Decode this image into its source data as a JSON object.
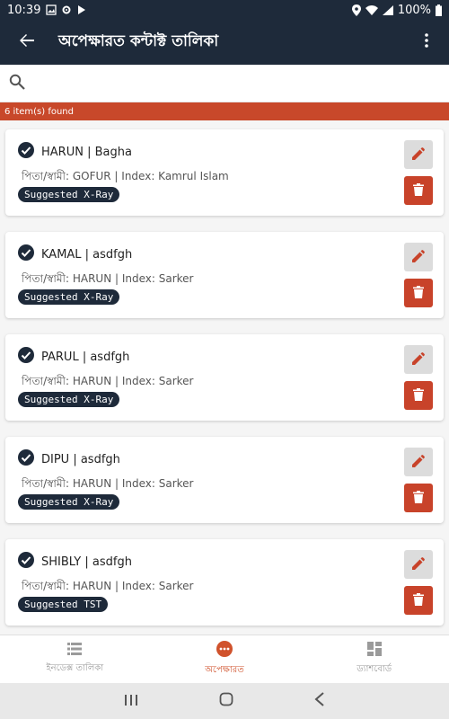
{
  "status_bar": {
    "time": "10:39",
    "battery": "100%"
  },
  "app_bar": {
    "title": "অপেক্ষারত কন্টাক্ট তালিকা"
  },
  "search": {
    "placeholder": ""
  },
  "results": {
    "count_text": "6 item(s) found"
  },
  "items": [
    {
      "name": "HARUN | Bagha",
      "parent": "পিতা/স্বামী: GOFUR | Index: Kamrul Islam",
      "badge": "Suggested X-Ray"
    },
    {
      "name": "KAMAL | asdfgh",
      "parent": "পিতা/স্বামী: HARUN | Index: Sarker",
      "badge": "Suggested X-Ray"
    },
    {
      "name": "PARUL | asdfgh",
      "parent": "পিতা/স্বামী: HARUN | Index: Sarker",
      "badge": "Suggested X-Ray"
    },
    {
      "name": "DIPU | asdfgh",
      "parent": "পিতা/স্বামী: HARUN | Index: Sarker",
      "badge": "Suggested X-Ray"
    },
    {
      "name": "SHIBLY | asdfgh",
      "parent": "পিতা/স্বামী: HARUN | Index: Sarker",
      "badge": "Suggested TST"
    }
  ],
  "bottom_nav": [
    {
      "label": "ইনডেক্স তালিকা",
      "icon": "list-icon",
      "active": false
    },
    {
      "label": "অপেক্ষারত",
      "icon": "more-circle-icon",
      "active": true
    },
    {
      "label": "ড্যাশবোর্ড",
      "icon": "dashboard-icon",
      "active": false
    }
  ],
  "colors": {
    "primary": "#1e2a3a",
    "accent": "#c8482a",
    "delete": "#c8432a"
  }
}
